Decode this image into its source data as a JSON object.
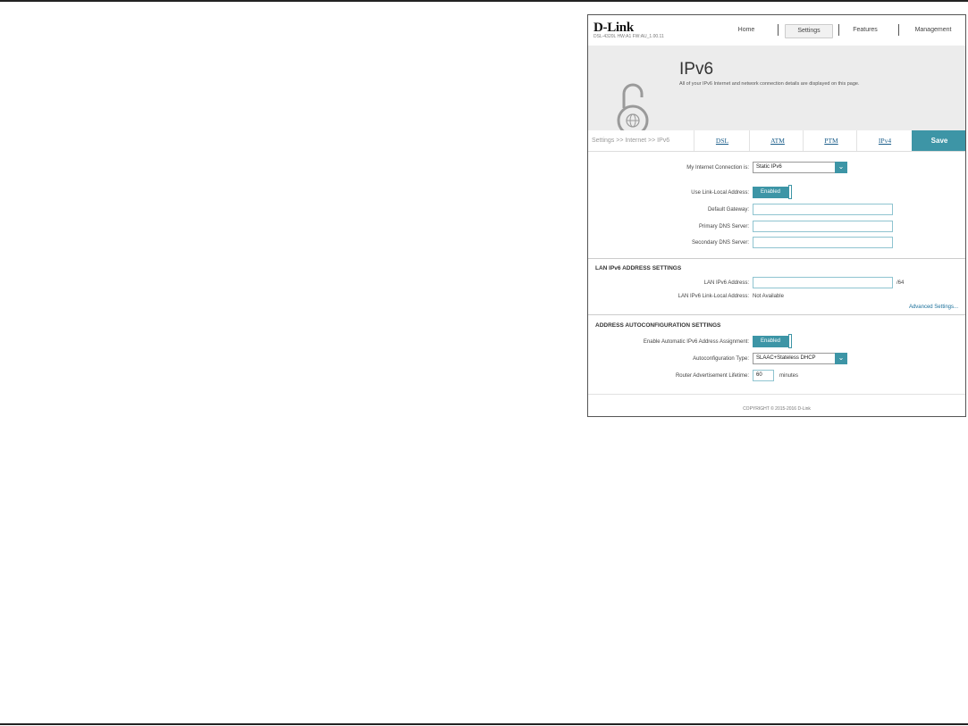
{
  "header": {
    "logo": "D-Link",
    "device_info": "DSL-4320L  HW:A1  FW:AU_1.00.11",
    "nav": {
      "home": "Home",
      "settings": "Settings",
      "features": "Features",
      "management": "Management"
    }
  },
  "banner": {
    "title": "IPv6",
    "description": "All of your IPv6 Internet and network connection details are displayed on this page."
  },
  "tabs": {
    "breadcrumb": "Settings >> Internet >> IPv6",
    "items": [
      "DSL",
      "ATM",
      "PTM",
      "IPv4"
    ],
    "save": "Save"
  },
  "form": {
    "connection_label": "My Internet Connection is:",
    "connection_value": "Static IPv6",
    "link_local_label": "Use Link-Local Address:",
    "link_local_value": "Enabled",
    "gateway_label": "Default Gateway:",
    "primary_dns_label": "Primary DNS Server:",
    "secondary_dns_label": "Secondary DNS Server:"
  },
  "lan": {
    "title": "LAN IPv6 ADDRESS SETTINGS",
    "address_label": "LAN IPv6 Address:",
    "prefix_suffix": "/64",
    "link_local_label": "LAN IPv6 Link-Local Address:",
    "link_local_value": "Not Available",
    "advanced_link": "Advanced Settings..."
  },
  "autoconfig": {
    "title": "ADDRESS AUTOCONFIGURATION SETTINGS",
    "enable_label": "Enable Automatic IPv6 Address Assignment:",
    "enable_value": "Enabled",
    "type_label": "Autoconfiguration Type:",
    "type_value": "SLAAC+Stateless DHCP",
    "lifetime_label": "Router Advertisement Lifetime:",
    "lifetime_value": "60",
    "lifetime_unit": "minutes"
  },
  "footer": {
    "copyright": "COPYRIGHT © 2015-2016 D-Link"
  },
  "colors": {
    "accent": "#3d95a6",
    "link": "#1a5d8a",
    "banner_bg": "#ececec"
  },
  "icons": {
    "banner": "open-lock-globe-icon",
    "dropdown": "chevron-down-icon"
  }
}
